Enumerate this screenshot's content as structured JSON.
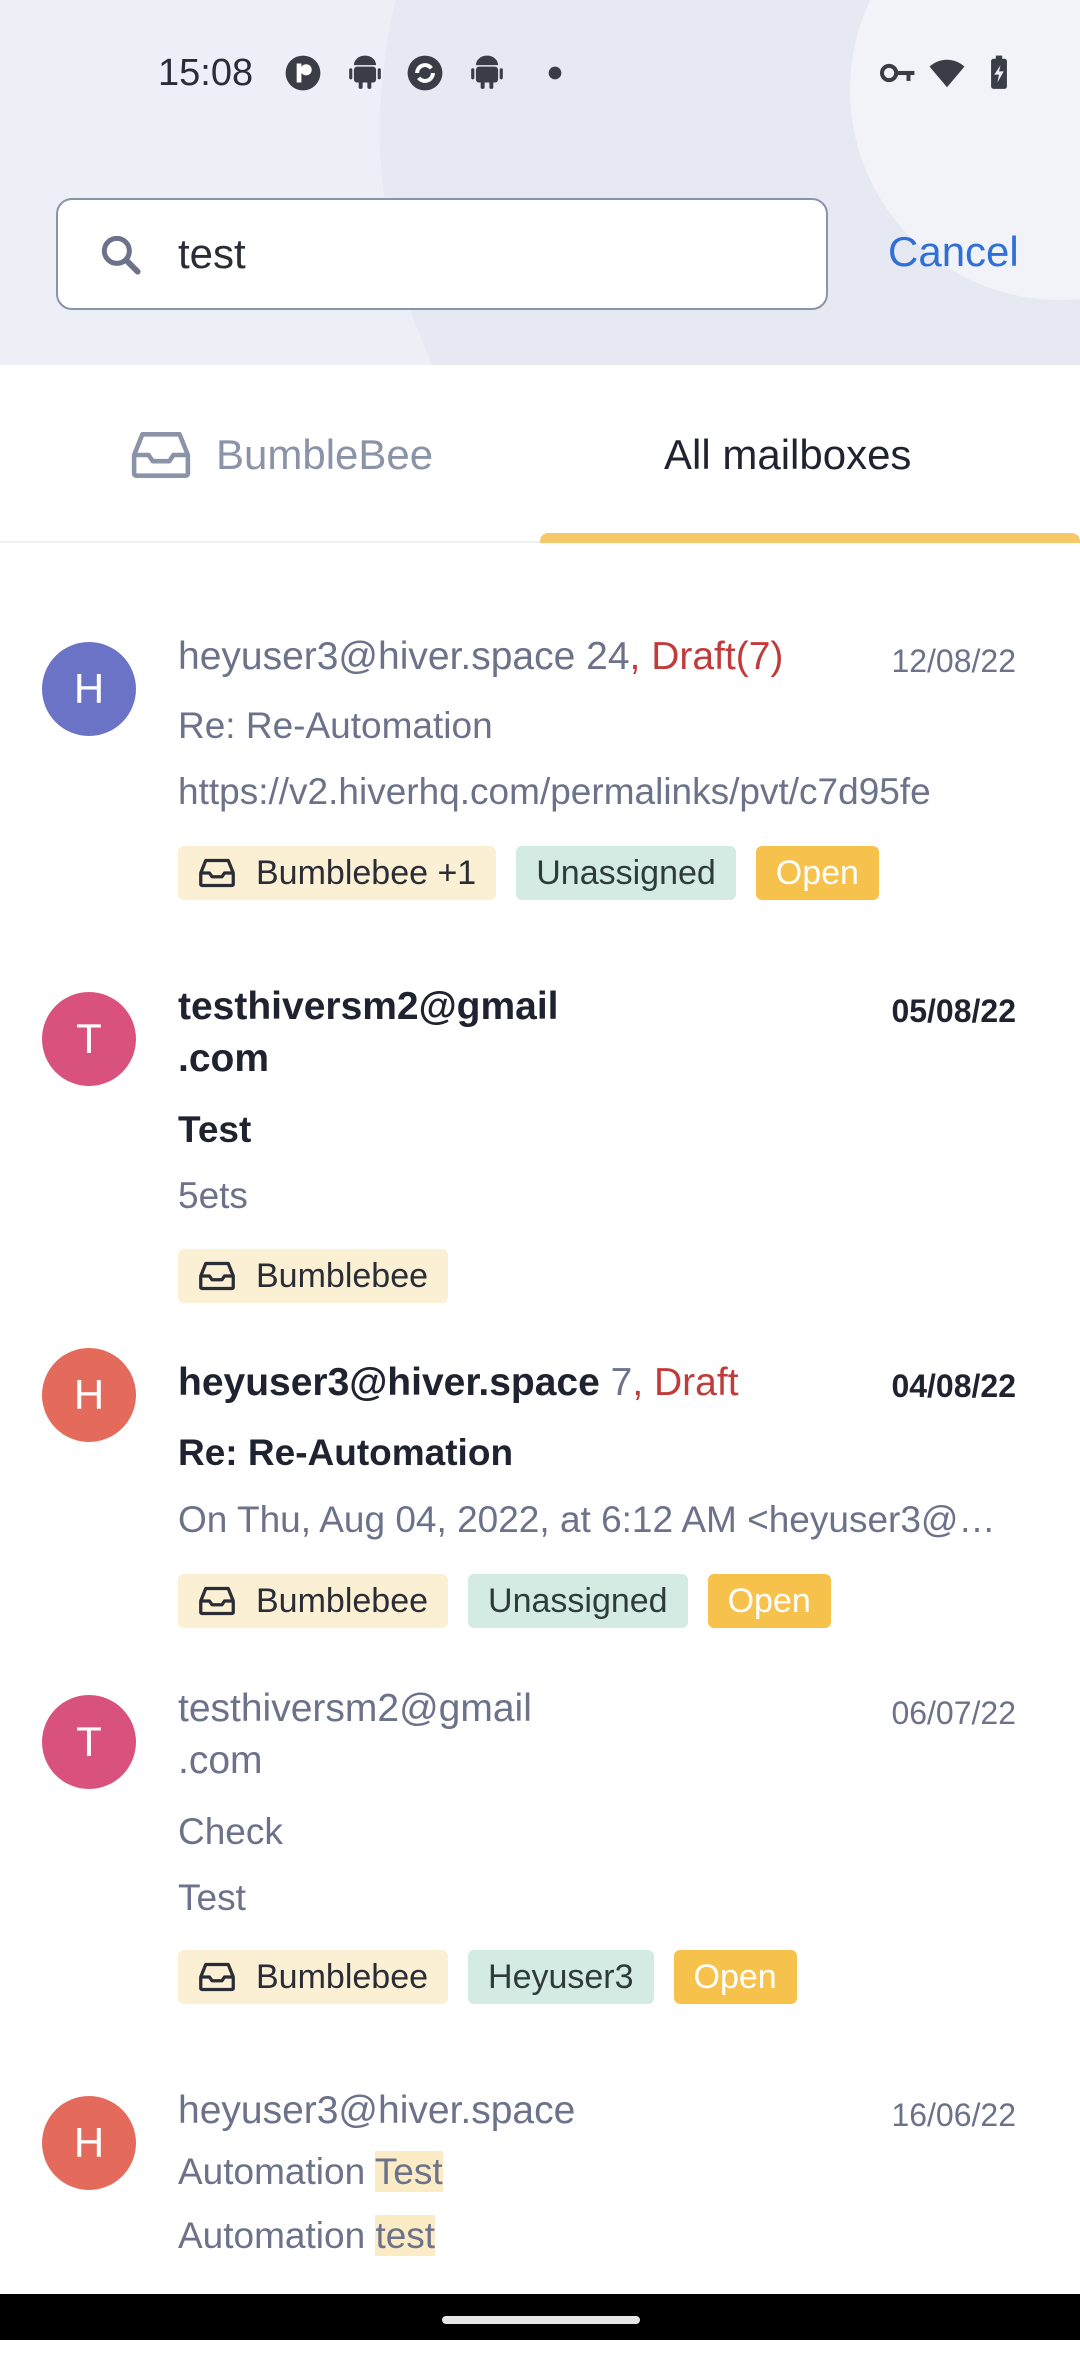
{
  "status_bar": {
    "time": "15:08"
  },
  "search": {
    "value": "test",
    "cancel_label": "Cancel"
  },
  "tabs": [
    {
      "label": "BumbleBee",
      "active": false
    },
    {
      "label": "All mailboxes",
      "active": true
    }
  ],
  "conversations": [
    {
      "avatar_letter": "H",
      "avatar_color": "#6b73c6",
      "sender": "heyuser3@hiver.space",
      "count": "24",
      "draft": ", Draft(7)",
      "date": "12/08/22",
      "subject": "Re:                Re-Automation",
      "preview": "https://v2.hiverhq.com/permalinks/pvt/c7d95fe",
      "mailbox_tag": "Bumblebee  +1",
      "assignee_tag": "Unassigned",
      "status_tag": "Open"
    },
    {
      "avatar_letter": "T",
      "avatar_color": "#d9527e",
      "sender_line1": "testhiversm2@gmail",
      "sender_line2": ".com",
      "date": "05/08/22",
      "subject": "Test",
      "preview": "5ets",
      "mailbox_tag": "Bumblebee"
    },
    {
      "avatar_letter": "H",
      "avatar_color": "#e46b5c",
      "sender": "heyuser3@hiver.space",
      "count": "7",
      "draft": ", Draft",
      "date": "04/08/22",
      "subject": "Re:     Re-Automation",
      "preview": "On Thu, Aug 04, 2022, at 6:12 AM <heyuser3@…",
      "mailbox_tag": "Bumblebee",
      "assignee_tag": "Unassigned",
      "status_tag": "Open"
    },
    {
      "avatar_letter": "T",
      "avatar_color": "#d9527e",
      "sender_line1": "testhiversm2@gmail",
      "sender_line2": ".com",
      "date": "06/07/22",
      "subject": "Check",
      "preview": "Test",
      "mailbox_tag": "Bumblebee",
      "assignee_tag": "Heyuser3",
      "status_tag": "Open"
    },
    {
      "avatar_letter": "H",
      "avatar_color": "#e46b5c",
      "sender": "heyuser3@hiver.space",
      "date": "16/06/22",
      "subject_prefix": "Automation ",
      "subject_highlight": "Test",
      "preview_prefix": "Automation ",
      "preview_highlight": "test"
    }
  ]
}
